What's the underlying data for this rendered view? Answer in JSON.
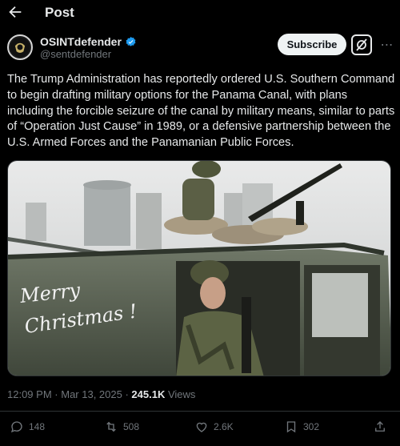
{
  "header": {
    "title": "Post",
    "back_icon": "arrow-left-icon"
  },
  "author": {
    "name": "OSINTdefender",
    "handle": "@sentdefender",
    "verified_icon": "verified-badge-icon",
    "verified_color": "#1d9bf0"
  },
  "actions_top": {
    "subscribe_label": "Subscribe",
    "grok_icon": "grok-icon",
    "more_icon": "more-icon"
  },
  "tweet": {
    "text": "The Trump Administration has reportedly ordered U.S. Southern Command to begin drafting military options for the Panama Canal, with plans including the forcible seizure of the canal by military means, similar to parts of “Operation Just Cause” in 1989, or a defensive partnership between the U.S. Armed Forces and the Panamanian Public Forces.",
    "image_handwriting": "Merry Christmas!",
    "time": "12:09 PM",
    "date": "Mar 13, 2025",
    "views_count": "245.1K",
    "views_label": "Views"
  },
  "engagement": {
    "replies": "148",
    "reposts": "508",
    "likes": "2.6K",
    "bookmarks": "302"
  },
  "colors": {
    "background": "#000000",
    "text": "#e7e9ea",
    "muted": "#71767b",
    "border": "#2f3336"
  }
}
